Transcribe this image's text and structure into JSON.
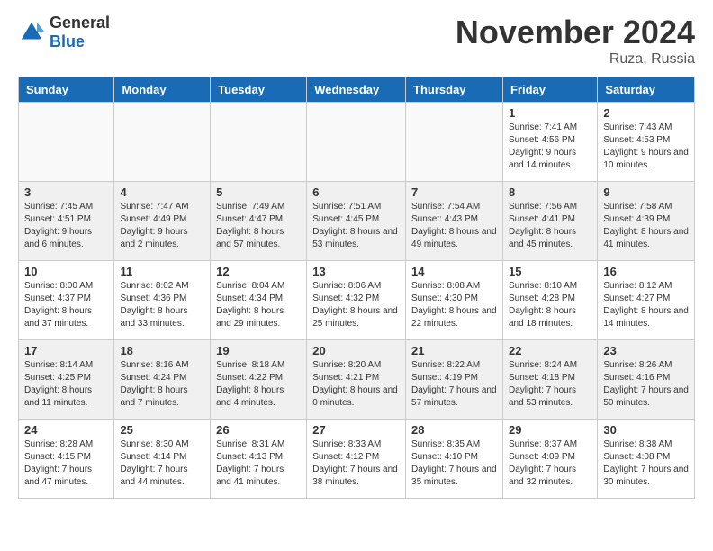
{
  "logo": {
    "general": "General",
    "blue": "Blue"
  },
  "header": {
    "month": "November 2024",
    "location": "Ruza, Russia"
  },
  "weekdays": [
    "Sunday",
    "Monday",
    "Tuesday",
    "Wednesday",
    "Thursday",
    "Friday",
    "Saturday"
  ],
  "weeks": [
    [
      {
        "day": "",
        "detail": ""
      },
      {
        "day": "",
        "detail": ""
      },
      {
        "day": "",
        "detail": ""
      },
      {
        "day": "",
        "detail": ""
      },
      {
        "day": "",
        "detail": ""
      },
      {
        "day": "1",
        "detail": "Sunrise: 7:41 AM\nSunset: 4:56 PM\nDaylight: 9 hours and 14 minutes."
      },
      {
        "day": "2",
        "detail": "Sunrise: 7:43 AM\nSunset: 4:53 PM\nDaylight: 9 hours and 10 minutes."
      }
    ],
    [
      {
        "day": "3",
        "detail": "Sunrise: 7:45 AM\nSunset: 4:51 PM\nDaylight: 9 hours and 6 minutes."
      },
      {
        "day": "4",
        "detail": "Sunrise: 7:47 AM\nSunset: 4:49 PM\nDaylight: 9 hours and 2 minutes."
      },
      {
        "day": "5",
        "detail": "Sunrise: 7:49 AM\nSunset: 4:47 PM\nDaylight: 8 hours and 57 minutes."
      },
      {
        "day": "6",
        "detail": "Sunrise: 7:51 AM\nSunset: 4:45 PM\nDaylight: 8 hours and 53 minutes."
      },
      {
        "day": "7",
        "detail": "Sunrise: 7:54 AM\nSunset: 4:43 PM\nDaylight: 8 hours and 49 minutes."
      },
      {
        "day": "8",
        "detail": "Sunrise: 7:56 AM\nSunset: 4:41 PM\nDaylight: 8 hours and 45 minutes."
      },
      {
        "day": "9",
        "detail": "Sunrise: 7:58 AM\nSunset: 4:39 PM\nDaylight: 8 hours and 41 minutes."
      }
    ],
    [
      {
        "day": "10",
        "detail": "Sunrise: 8:00 AM\nSunset: 4:37 PM\nDaylight: 8 hours and 37 minutes."
      },
      {
        "day": "11",
        "detail": "Sunrise: 8:02 AM\nSunset: 4:36 PM\nDaylight: 8 hours and 33 minutes."
      },
      {
        "day": "12",
        "detail": "Sunrise: 8:04 AM\nSunset: 4:34 PM\nDaylight: 8 hours and 29 minutes."
      },
      {
        "day": "13",
        "detail": "Sunrise: 8:06 AM\nSunset: 4:32 PM\nDaylight: 8 hours and 25 minutes."
      },
      {
        "day": "14",
        "detail": "Sunrise: 8:08 AM\nSunset: 4:30 PM\nDaylight: 8 hours and 22 minutes."
      },
      {
        "day": "15",
        "detail": "Sunrise: 8:10 AM\nSunset: 4:28 PM\nDaylight: 8 hours and 18 minutes."
      },
      {
        "day": "16",
        "detail": "Sunrise: 8:12 AM\nSunset: 4:27 PM\nDaylight: 8 hours and 14 minutes."
      }
    ],
    [
      {
        "day": "17",
        "detail": "Sunrise: 8:14 AM\nSunset: 4:25 PM\nDaylight: 8 hours and 11 minutes."
      },
      {
        "day": "18",
        "detail": "Sunrise: 8:16 AM\nSunset: 4:24 PM\nDaylight: 8 hours and 7 minutes."
      },
      {
        "day": "19",
        "detail": "Sunrise: 8:18 AM\nSunset: 4:22 PM\nDaylight: 8 hours and 4 minutes."
      },
      {
        "day": "20",
        "detail": "Sunrise: 8:20 AM\nSunset: 4:21 PM\nDaylight: 8 hours and 0 minutes."
      },
      {
        "day": "21",
        "detail": "Sunrise: 8:22 AM\nSunset: 4:19 PM\nDaylight: 7 hours and 57 minutes."
      },
      {
        "day": "22",
        "detail": "Sunrise: 8:24 AM\nSunset: 4:18 PM\nDaylight: 7 hours and 53 minutes."
      },
      {
        "day": "23",
        "detail": "Sunrise: 8:26 AM\nSunset: 4:16 PM\nDaylight: 7 hours and 50 minutes."
      }
    ],
    [
      {
        "day": "24",
        "detail": "Sunrise: 8:28 AM\nSunset: 4:15 PM\nDaylight: 7 hours and 47 minutes."
      },
      {
        "day": "25",
        "detail": "Sunrise: 8:30 AM\nSunset: 4:14 PM\nDaylight: 7 hours and 44 minutes."
      },
      {
        "day": "26",
        "detail": "Sunrise: 8:31 AM\nSunset: 4:13 PM\nDaylight: 7 hours and 41 minutes."
      },
      {
        "day": "27",
        "detail": "Sunrise: 8:33 AM\nSunset: 4:12 PM\nDaylight: 7 hours and 38 minutes."
      },
      {
        "day": "28",
        "detail": "Sunrise: 8:35 AM\nSunset: 4:10 PM\nDaylight: 7 hours and 35 minutes."
      },
      {
        "day": "29",
        "detail": "Sunrise: 8:37 AM\nSunset: 4:09 PM\nDaylight: 7 hours and 32 minutes."
      },
      {
        "day": "30",
        "detail": "Sunrise: 8:38 AM\nSunset: 4:08 PM\nDaylight: 7 hours and 30 minutes."
      }
    ]
  ]
}
